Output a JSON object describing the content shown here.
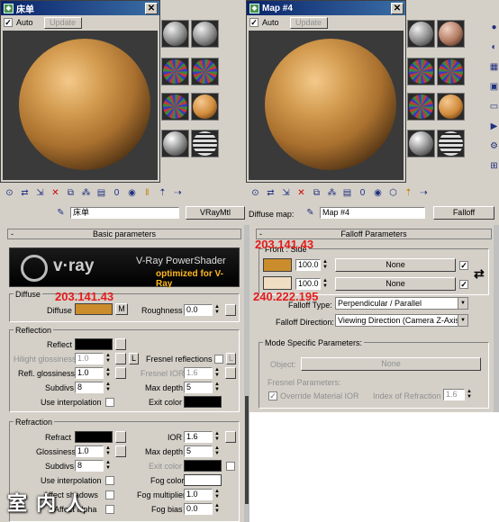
{
  "left_window": {
    "title": "床单",
    "auto": "Auto",
    "update": "Update"
  },
  "right_window": {
    "title": "Map #4",
    "auto": "Auto",
    "update": "Update"
  },
  "left_panel": {
    "material_name": "床单",
    "material_type": "VRayMtl",
    "basic_parameters": "Basic parameters",
    "logo": {
      "brand": "v·ray",
      "product": "V-Ray PowerShader",
      "tagline": "optimized for V-Ray"
    },
    "diffuse": {
      "group": "Diffuse",
      "rgb_note": "203.141.43",
      "label": "Diffuse",
      "map_btn": "M",
      "roughness_label": "Roughness",
      "roughness": "0.0"
    },
    "reflection": {
      "group": "Reflection",
      "reflect": "Reflect",
      "hilight_glossiness": "Hilight glossiness",
      "hilight_val": "1.0",
      "lock": "L",
      "fresnel": "Fresnel reflections",
      "fresnel_lock": "L",
      "refl_glossiness": "Refl. glossiness",
      "refl_val": "1.0",
      "fresnel_ior": "Fresnel IOR",
      "fresnel_ior_val": "1.6",
      "subdivs": "Subdivs",
      "subdivs_val": "8",
      "max_depth": "Max depth",
      "max_depth_val": "5",
      "use_interp": "Use interpolation",
      "exit_color": "Exit color"
    },
    "refraction": {
      "group": "Refraction",
      "refract": "Refract",
      "ior": "IOR",
      "ior_val": "1.6",
      "glossiness": "Glossiness",
      "gloss_val": "1.0",
      "max_depth": "Max depth",
      "max_depth_val": "5",
      "subdivs": "Subdivs",
      "subdivs_val": "8",
      "exit_color": "Exit color",
      "use_interp": "Use interpolation",
      "fog_color": "Fog color",
      "fog_mult": "Fog multiplier",
      "fog_mult_val": "1.0",
      "affect_shadows": "Affect shadows",
      "fog_bias": "Fog bias",
      "fog_bias_val": "0.0",
      "affect_alpha": "Affect alpha"
    }
  },
  "right_panel": {
    "diffuse_map_label": "Diffuse map:",
    "map_name": "Map #4",
    "map_type": "Falloff",
    "falloff_parameters": "Falloff Parameters",
    "front_side": "Front : Side",
    "color1_note": "203.141.43",
    "color2_note": "240.222.195",
    "amount1": "100.0",
    "amount2": "100.0",
    "none1": "None",
    "none2": "None",
    "falloff_type_label": "Falloff Type:",
    "falloff_type": "Perpendicular / Parallel",
    "falloff_dir_label": "Falloff Direction:",
    "falloff_dir": "Viewing Direction (Camera Z-Axis)",
    "mode_specific": "Mode Specific Parameters:",
    "object_label": "Object:",
    "object_val": "None",
    "fresnel_params": "Fresnel Parameters:",
    "override": "Override Material IOR",
    "index_label": "Index of Refraction",
    "index_val": "1.6"
  },
  "watermark": "室 内 人",
  "colors": {
    "diffuse": "#cb8d2b",
    "color2": "#f0dec3",
    "red_note": "#e51b1b"
  }
}
